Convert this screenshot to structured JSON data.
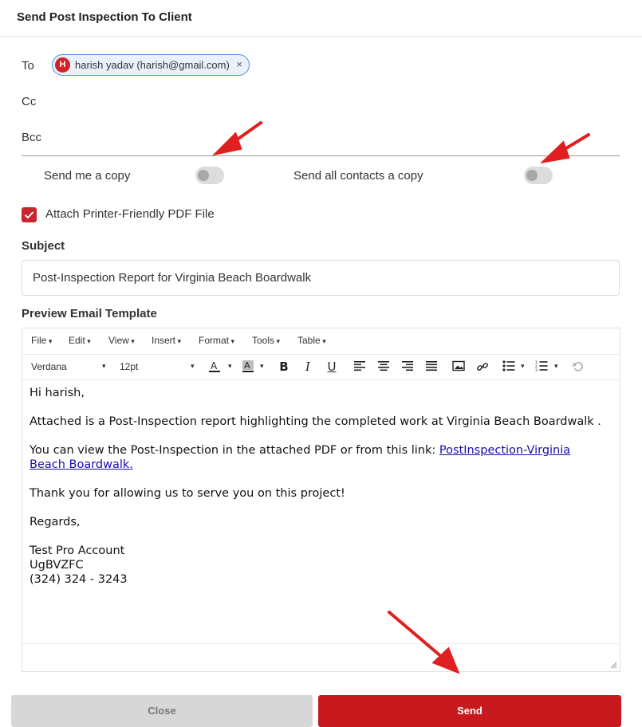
{
  "header": {
    "title": "Send Post Inspection To Client"
  },
  "recipients": {
    "to_label": "To",
    "cc_label": "Cc",
    "bcc_label": "Bcc",
    "to_chips": [
      {
        "initial": "H",
        "text": "harish yadav (harish@gmail.com)",
        "remove": "×"
      }
    ]
  },
  "options": {
    "send_me_copy_label": "Send me a copy",
    "send_me_copy_on": false,
    "send_all_contacts_label": "Send all contacts a copy",
    "send_all_contacts_on": false,
    "attach_pdf_label": "Attach Printer-Friendly PDF File",
    "attach_pdf_checked": true
  },
  "subject": {
    "label": "Subject",
    "value": "Post-Inspection Report for Virginia Beach Boardwalk"
  },
  "editor": {
    "label": "Preview Email Template",
    "menu": [
      "File",
      "Edit",
      "View",
      "Insert",
      "Format",
      "Tools",
      "Table"
    ],
    "font_family": "Verdana",
    "font_size": "12pt",
    "body": {
      "greeting": "Hi harish,",
      "para1": "Attached is a Post-Inspection report highlighting the completed work at Virginia Beach Boardwalk .",
      "para2_prefix": "You can view the Post-Inspection in the attached PDF or from this link: ",
      "para2_link": "PostInspection-Virginia Beach Boardwalk.",
      "para3": "Thank you for allowing us to serve you on this project!",
      "closing": "Regards,",
      "sig_name": "Test Pro Account",
      "sig_code": "UgBVZFC",
      "sig_phone": "(324) 324 - 3243"
    }
  },
  "footer": {
    "close_label": "Close",
    "send_label": "Send"
  },
  "colors": {
    "accent": "#c8191f",
    "chip_border": "#4a90d9",
    "arrow": "#e02020"
  }
}
